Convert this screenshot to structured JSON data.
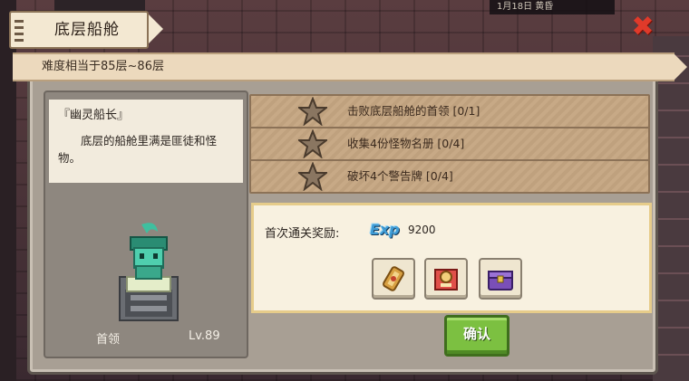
{
  "dialog": {
    "title": "底层船舱",
    "difficulty": "难度相当于85层~86层"
  },
  "boss": {
    "name": "『幽灵船长』",
    "description": "底层的船舱里满是匪徒和怪物。",
    "label": "首领",
    "level": "Lv.89"
  },
  "quests": [
    {
      "text": "击败底层船舱的首领 [0/1]"
    },
    {
      "text": "收集4份怪物名册 [0/4]"
    },
    {
      "text": "破坏4个警告牌 [0/4]"
    }
  ],
  "reward": {
    "label": "首次通关奖励:",
    "exp_icon_text": "Exp",
    "exp_value": "9200",
    "items": [
      {
        "icon": "scroll-icon"
      },
      {
        "icon": "portrait-card-icon"
      },
      {
        "icon": "treasure-chest-icon"
      }
    ]
  },
  "buttons": {
    "confirm": "确认",
    "close": "✖"
  },
  "hud": {
    "date": "1月18日 黄昏"
  },
  "colors": {
    "confirm_green": "#7cc041",
    "close_red": "#e03a2a",
    "exp_blue": "#3f9cd6"
  }
}
